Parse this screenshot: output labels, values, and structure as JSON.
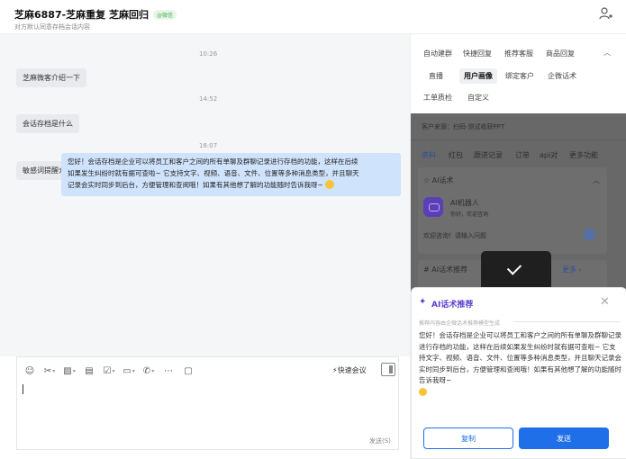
{
  "header": {
    "title": "芝麻6887-芝麻重复 芝麻回归",
    "tag": "@微信",
    "subtitle": "对方默认同意存档会话内容"
  },
  "chat": {
    "messages": [
      {
        "time": "10:26",
        "text": "芝麻微客介绍一下"
      },
      {
        "time": "14:52",
        "text": "会话存档是什么"
      },
      {
        "time": "16:07",
        "text": "敏感词提醒介绍"
      }
    ],
    "reply": {
      "line1": "您好！会话存档是企业可以将员工和客户之间的所有单聊及群聊记录进行存档的功能，这样在后续",
      "line2": "如果发生纠纷时就有据可查啦~ 它支持文字、视频、语音、文件、位置等多种消息类型，并且聊天",
      "line3": "记录会实时同步到后台，方便管理和查阅哦！如果有其他想了解的功能随时告诉我呀~"
    }
  },
  "composer": {
    "quick_meeting": "快速会议",
    "send_hint": "发送(S)"
  },
  "right_panel": {
    "tabs_row1": [
      "自动建群",
      "快捷回复",
      "推荐客服",
      "商品回复"
    ],
    "tabs_row2": [
      "直播",
      "用户画像",
      "绑定客户",
      "企微话术"
    ],
    "tabs_row3": [
      "工单质检",
      "自定义"
    ],
    "active_tab": "用户画像",
    "customer_source": "客户来源：扫码-测试收获PPT",
    "sub_tabs": [
      "资料",
      "红包",
      "跟进记录",
      "订单",
      "api对",
      "更多功能"
    ],
    "ai_section_title": "AI话术",
    "robot_name": "AI机器人",
    "robot_greeting": "你好，欢迎咨询",
    "chat_placeholder": "欢迎咨询！请输入问题",
    "recommend_title": "AI话术推荐",
    "more_label": "更多",
    "popup": {
      "title": "AI话术推荐",
      "note": "推荐内容由企微话术推荐模型生成",
      "body": "您好！会话存档是企业可以将员工和客户之间的所有单聊及群聊记录进行存档的功能，这样在后续如果发生纠纷时就有据可查啦~ 它支持文字、视频、语音、文件、位置等多种消息类型，并且聊天记录会实时同步到后台，方便管理和查阅哦！如果有其他想了解的功能随时告诉我呀~",
      "copy": "复制",
      "send": "发送"
    }
  },
  "colors": {
    "accent": "#1e6fe8",
    "ai_purple": "#5b3fd0",
    "reply_bubble": "#cfe3fc"
  }
}
